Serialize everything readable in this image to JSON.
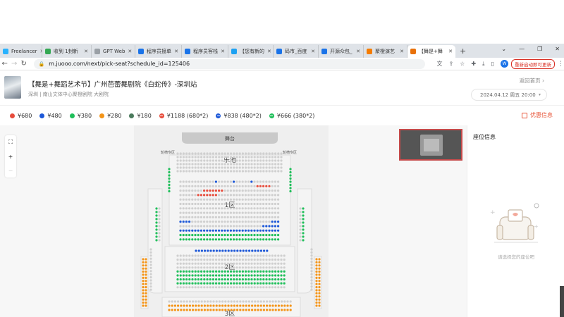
{
  "browser": {
    "tabs": [
      {
        "label": "Freelancer",
        "color": "#29b2fe"
      },
      {
        "label": "收到 1封新",
        "color": "#34a853"
      },
      {
        "label": "GPT Web",
        "color": "#9aa0a6"
      },
      {
        "label": "程序员接单",
        "color": "#1a73e8"
      },
      {
        "label": "程序员客栈",
        "color": "#1a73e8"
      },
      {
        "label": "【您有新的",
        "color": "#1da1f2"
      },
      {
        "label": "码市_百度",
        "color": "#1a73e8"
      },
      {
        "label": "开源众包_",
        "color": "#1a73e8"
      },
      {
        "label": "聚橙演艺",
        "color": "#f57c00"
      },
      {
        "label": "【舞是+舞",
        "color": "#e8710a"
      }
    ],
    "url": "m.juooo.com/next/pick-seat?schedule_id=125406",
    "profile_initial": "W",
    "restart_label": "重新启动即可更新"
  },
  "header": {
    "title": "【舞是+舞蹈艺术节】广州芭蕾舞剧院《白蛇传》-深圳站",
    "venue": "深圳 | 南山文体中心聚橙剧院 大剧院",
    "back_home": "返回首页 ›",
    "date": "2024.04.12 周五 20:00"
  },
  "legend": {
    "prices": [
      {
        "label": "¥680",
        "color": "#e74c3c"
      },
      {
        "label": "¥480",
        "color": "#1d58d8"
      },
      {
        "label": "¥380",
        "color": "#1fbf5a"
      },
      {
        "label": "¥280",
        "color": "#f39418"
      },
      {
        "label": "¥180",
        "color": "#4a7a5c"
      }
    ],
    "packages": [
      {
        "label": "¥1188 (680*2)",
        "color": "#e74c3c"
      },
      {
        "label": "¥838 (480*2)",
        "color": "#1d58d8"
      },
      {
        "label": "¥666 (380*2)",
        "color": "#1fbf5a"
      }
    ],
    "coupon_label": "优惠信息"
  },
  "seatmap": {
    "stage_label": "舞台",
    "wheelchair_left": "轮椅专区",
    "wheelchair_right": "轮椅专区",
    "zone_pit": "乐池",
    "zone1": "1区",
    "zone2": "2区",
    "zone3": "3区",
    "zoom_in": "+",
    "zoom_out": "−"
  },
  "panel": {
    "title": "座位信息",
    "empty_tip": "请选择您的座位吧"
  },
  "colors": {
    "sold": "#cfcfcf",
    "p680": "#e74c3c",
    "p480": "#1d58d8",
    "p380": "#1fbf5a",
    "p280": "#f39418"
  }
}
